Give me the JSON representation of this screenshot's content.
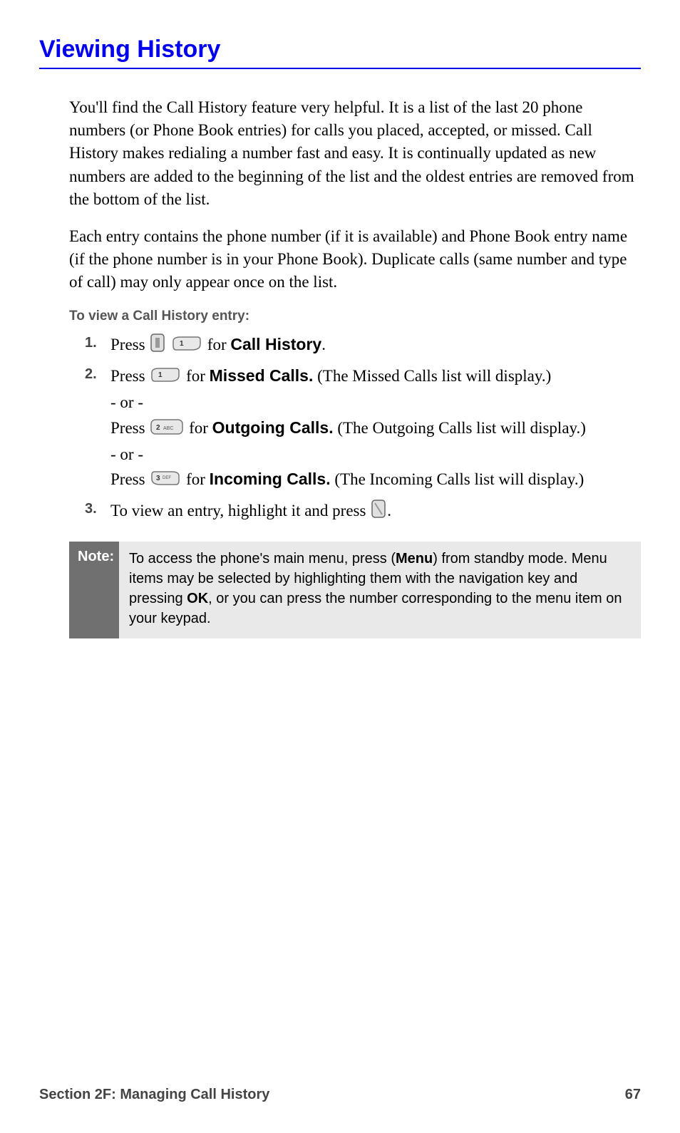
{
  "heading": "Viewing History",
  "para1": "You'll find the Call History feature very helpful. It is a list of the last 20 phone numbers (or Phone Book entries) for calls you placed, accepted, or missed. Call History makes redialing a number fast and easy. It is continually updated as new numbers are added to the beginning of the list and the oldest entries are removed from the bottom of the list.",
  "para2": "Each entry contains the phone number (if it is available) and Phone Book entry name (if the phone number is in your Phone Book). Duplicate calls (same number and type of call) may only appear once on the list.",
  "subheading": "To view a Call History entry:",
  "steps": {
    "s1": {
      "num": "1.",
      "press": "Press ",
      "for": " for ",
      "target": "Call History",
      "end": "."
    },
    "s2": {
      "num": "2.",
      "a_press": "Press ",
      "a_for": " for ",
      "a_target": "Missed Calls.",
      "a_tail": " (The Missed Calls list will display.)",
      "or": "- or -",
      "b_press": "Press ",
      "b_for": " for ",
      "b_target": "Outgoing Calls.",
      "b_tail": " (The Outgoing Calls list will display.)",
      "c_press": "Press ",
      "c_for": " for ",
      "c_target": "Incoming Calls.",
      "c_tail": " (The Incoming Calls list will display.)"
    },
    "s3": {
      "num": "3.",
      "text": "To view an entry, highlight it and press ",
      "end": "."
    }
  },
  "note": {
    "label": "Note:",
    "t1": "To access the phone's main menu, press (",
    "menu": "Menu",
    "t2": ") from standby mode. Menu items may be selected by highlighting them with the navigation key and pressing ",
    "ok": "OK",
    "t3": ", or you can press the number corresponding to the menu item on your keypad."
  },
  "footer": {
    "section": "Section 2F: Managing Call History",
    "page": "67"
  }
}
